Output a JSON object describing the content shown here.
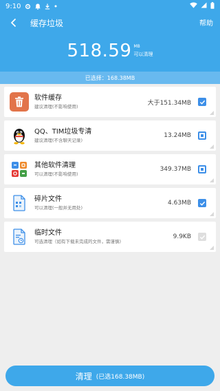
{
  "status": {
    "time": "9:10"
  },
  "nav": {
    "title": "缓存垃圾",
    "help": "帮助"
  },
  "summary": {
    "value": "518.59",
    "unit": "MB",
    "sub": "可以清理"
  },
  "selected": {
    "text": "已选择：168.38MB"
  },
  "items": [
    {
      "title": "软件缓存",
      "sub": "建议清理(不影响使用)",
      "size": "大于151.34MB",
      "state": "checked"
    },
    {
      "title": "QQ、TIM垃圾专清",
      "sub": "建议清理(不含聊天记录)",
      "size": "13.24MB",
      "state": "partial"
    },
    {
      "title": "其他软件清理",
      "sub": "可以清理(不影响使用)",
      "size": "349.37MB",
      "state": "partial"
    },
    {
      "title": "碎片文件",
      "sub": "可以清理(一般并无用处)",
      "size": "4.63MB",
      "state": "checked"
    },
    {
      "title": "临时文件",
      "sub": "可选清理（如有下载未完成的文件，需谨慎)",
      "size": "9.9KB",
      "state": "disabled"
    }
  ],
  "button": {
    "label": "清理",
    "detail": "(已选168.38MB)"
  },
  "colors": {
    "primary": "#3ea8ea",
    "checkbox": "#3d8fe8",
    "trash": "#e2744a"
  }
}
